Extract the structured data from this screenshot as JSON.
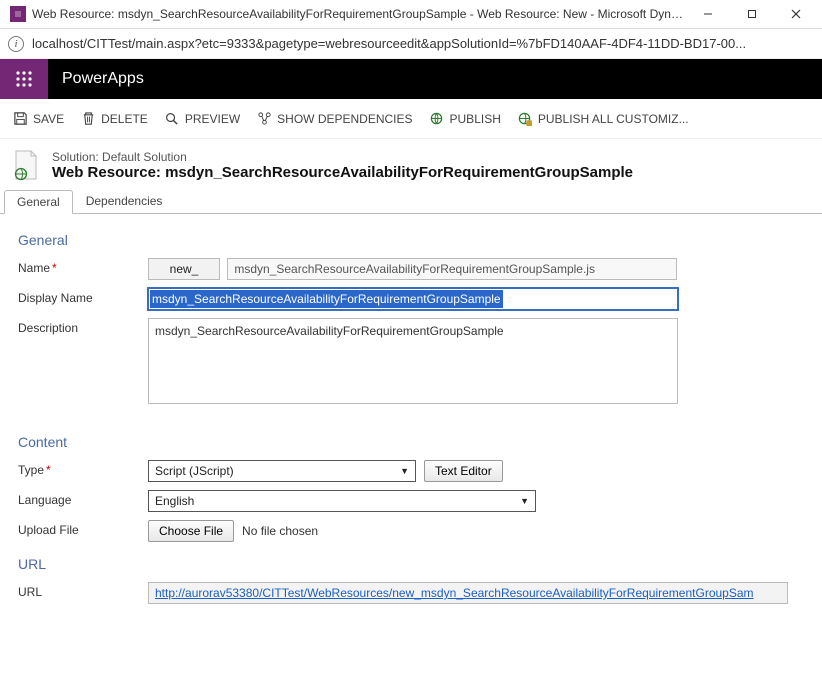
{
  "window": {
    "title": "Web Resource: msdyn_SearchResourceAvailabilityForRequirementGroupSample - Web Resource: New - Microsoft Dynamic..."
  },
  "addressbar": {
    "url": "localhost/CITTest/main.aspx?etc=9333&pagetype=webresourceedit&appSolutionId=%7bFD140AAF-4DF4-11DD-BD17-00..."
  },
  "powerapps_label": "PowerApps",
  "commands": {
    "save": "SAVE",
    "delete": "DELETE",
    "preview": "PREVIEW",
    "show_dependencies": "SHOW DEPENDENCIES",
    "publish": "PUBLISH",
    "publish_all": "PUBLISH ALL CUSTOMIZ..."
  },
  "header": {
    "solution_text": "Solution: Default Solution",
    "wr_prefix": "Web Resource: ",
    "wr_name": "msdyn_SearchResourceAvailabilityForRequirementGroupSample"
  },
  "tabs": {
    "general": "General",
    "dependencies": "Dependencies"
  },
  "sections": {
    "general": "General",
    "content": "Content",
    "url": "URL"
  },
  "labels": {
    "name": "Name",
    "display_name": "Display Name",
    "description": "Description",
    "type": "Type",
    "language": "Language",
    "upload_file": "Upload File",
    "url_label": "URL"
  },
  "fields": {
    "prefix": "new_",
    "name_value": "msdyn_SearchResourceAvailabilityForRequirementGroupSample.js",
    "display_name": "msdyn_SearchResourceAvailabilityForRequirementGroupSample",
    "description": "msdyn_SearchResourceAvailabilityForRequirementGroupSample",
    "type_selected": "Script (JScript)",
    "language_selected": "English",
    "text_editor_btn": "Text Editor",
    "choose_file_btn": "Choose File",
    "file_status": "No file chosen",
    "url_value": "http://aurorav53380/CITTest/WebResources/new_msdyn_SearchResourceAvailabilityForRequirementGroupSam"
  }
}
